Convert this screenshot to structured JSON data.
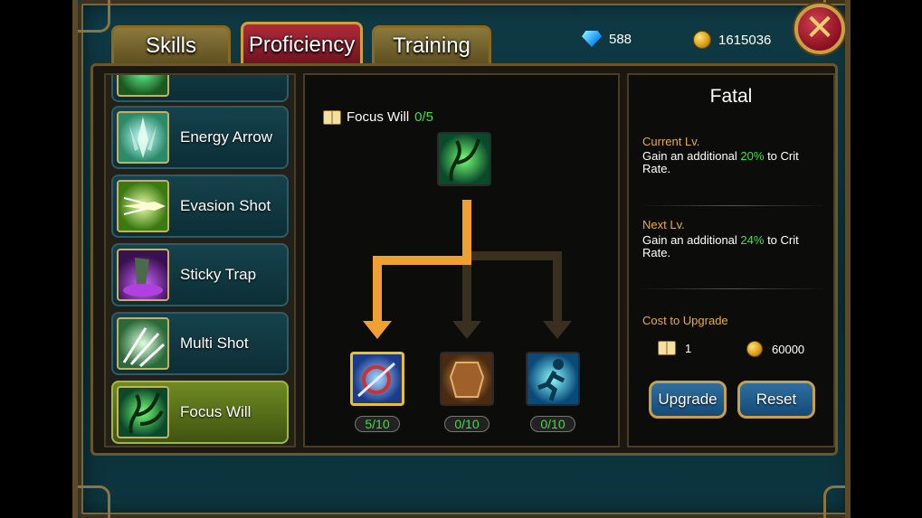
{
  "tabs": [
    {
      "label": "Skills"
    },
    {
      "label": "Proficiency"
    },
    {
      "label": "Training"
    }
  ],
  "currency": {
    "gems": "588",
    "gold": "1615036"
  },
  "close_icon": "close-x-icon",
  "skills": [
    {
      "name": "",
      "icon": "green-skill-icon"
    },
    {
      "name": "Energy Arrow",
      "icon": "energy-arrow-icon"
    },
    {
      "name": "Evasion Shot",
      "icon": "evasion-shot-icon"
    },
    {
      "name": "Sticky Trap",
      "icon": "sticky-trap-icon"
    },
    {
      "name": "Multi Shot",
      "icon": "multi-shot-icon"
    },
    {
      "name": "Focus Will",
      "icon": "focus-will-icon",
      "selected": true
    }
  ],
  "tree": {
    "root_name": "Focus Will",
    "root_level": "0/5",
    "nodes": [
      {
        "level": "5/10",
        "icon": "fatal-icon",
        "selected": true
      },
      {
        "level": "0/10",
        "icon": "armor-icon"
      },
      {
        "level": "0/10",
        "icon": "sprint-icon"
      }
    ]
  },
  "info": {
    "title": "Fatal",
    "current_label": "Current Lv.",
    "current_pre": "Gain an additional ",
    "current_value": "20%",
    "current_post": " to Crit Rate.",
    "next_label": "Next Lv.",
    "next_pre": "Gain an additional ",
    "next_value": "24%",
    "next_post": " to Crit Rate.",
    "cost_label": "Cost to Upgrade",
    "cost_books": "1",
    "cost_gold": "60000",
    "upgrade_label": "Upgrade",
    "reset_label": "Reset"
  },
  "colors": {
    "highlight_green": "#3ee03e",
    "gold_text": "#e0b040",
    "active_path": "#f0a030"
  }
}
